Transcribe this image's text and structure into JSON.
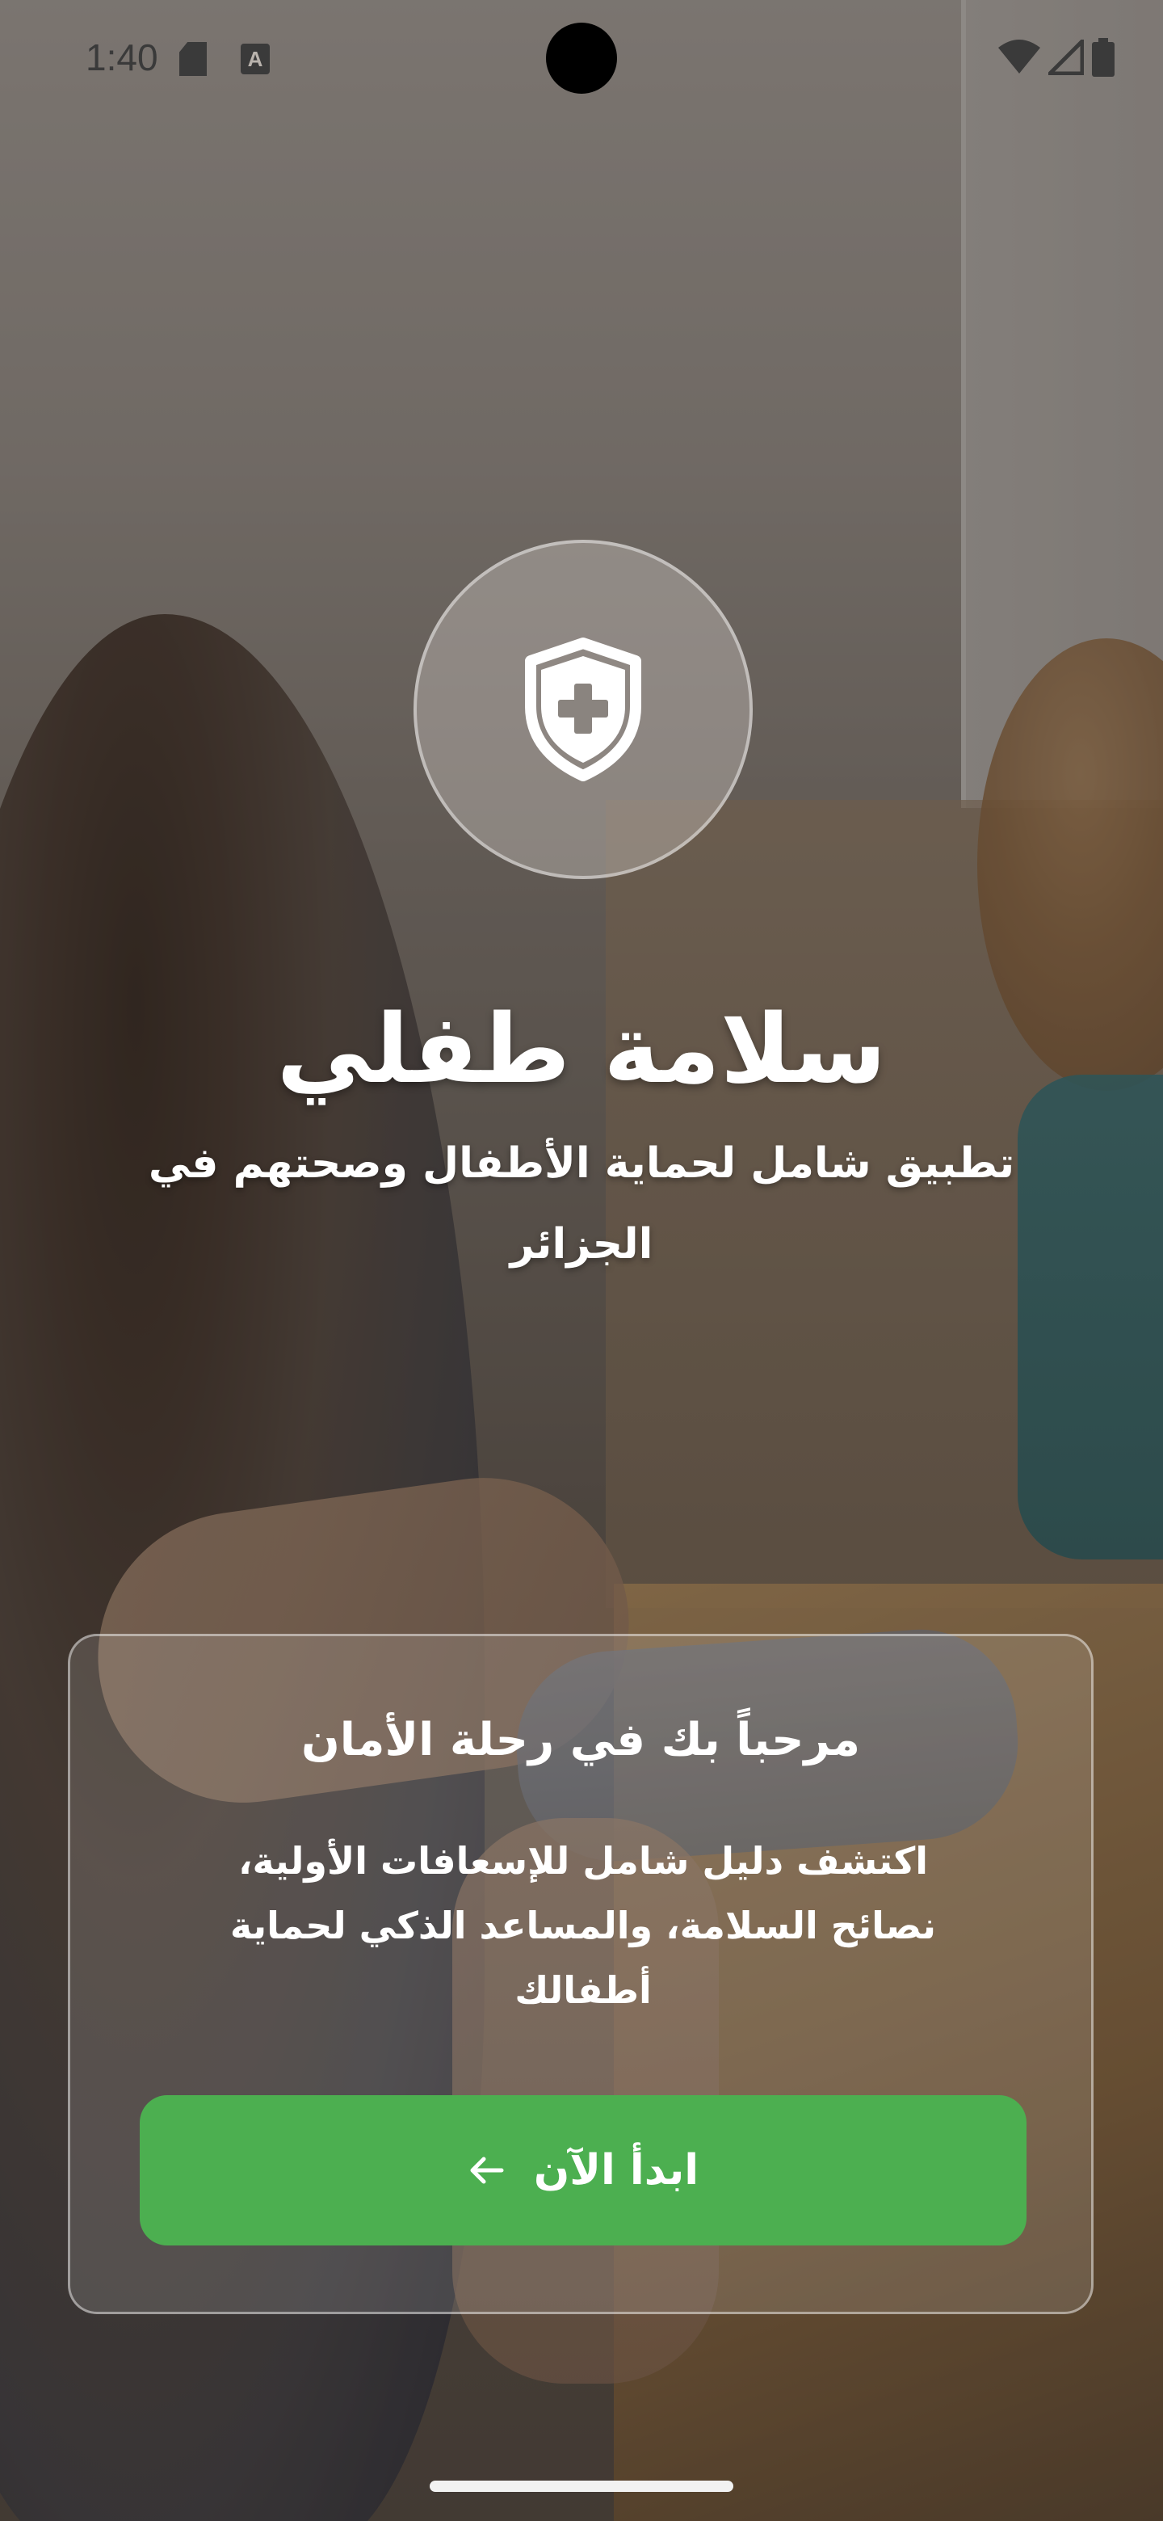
{
  "status_bar": {
    "time": "1:40",
    "icons": [
      "sd-card-icon",
      "keyboard-a-icon",
      "wifi-icon",
      "cell-signal-icon",
      "battery-icon"
    ]
  },
  "app": {
    "title": "سلامة طفلي",
    "subtitle": "تطبيق شامل لحماية الأطفال وصحتهم في الجزائر",
    "logo_icon": "shield-plus-icon"
  },
  "welcome_card": {
    "title": "مرحباً بك في رحلة الأمان",
    "body": "اكتشف دليل شامل للإسعافات الأولية، نصائح السلامة، والمساعد الذكي لحماية أطفالك",
    "start_button_label": "ابدأ الآن",
    "start_button_icon": "arrow-left-icon"
  },
  "colors": {
    "accent_green": "#4caf50",
    "text": "#ffffff"
  }
}
